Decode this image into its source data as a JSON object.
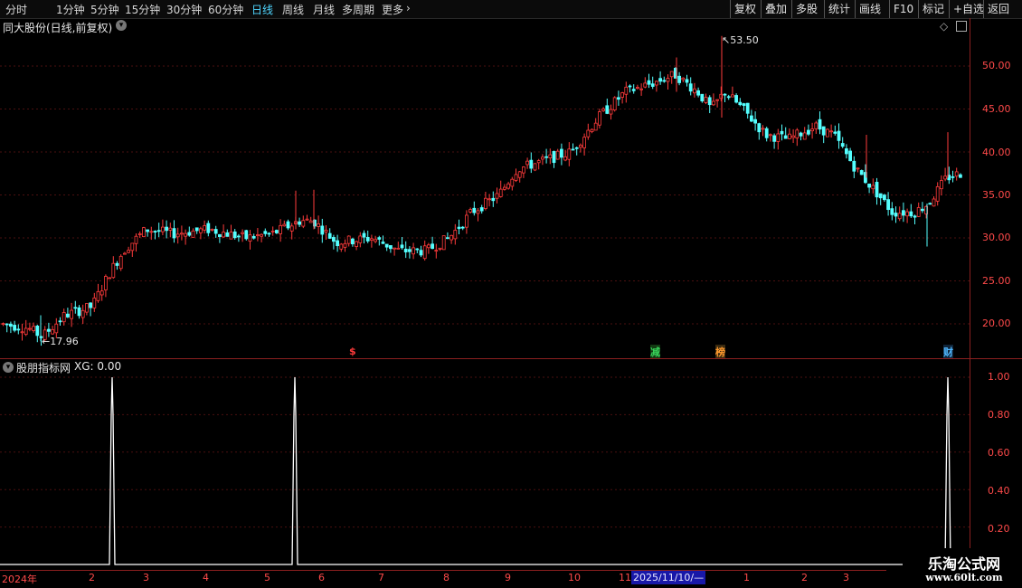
{
  "toolbar": {
    "periods": [
      "分时",
      "1分钟",
      "5分钟",
      "15分钟",
      "30分钟",
      "60分钟",
      "日线",
      "周线",
      "月线",
      "多周期",
      "更多"
    ],
    "active_period": "日线",
    "more_arrow": "›",
    "buttons": [
      "复权",
      "叠加",
      "多股",
      "统计",
      "画线",
      "F10",
      "标记",
      "+自选",
      "返回"
    ]
  },
  "main_panel": {
    "title": "同大股份(日线,前复权)",
    "price_axis": [
      "50.00",
      "45.00",
      "40.00",
      "35.00",
      "30.00",
      "25.00",
      "20.00"
    ],
    "high_label": "53.50",
    "low_label": "17.96",
    "markers": [
      {
        "text": "$",
        "color": "#ff3b3b"
      },
      {
        "text": "减",
        "color": "#38d45a"
      },
      {
        "text": "榜",
        "color": "#ff9a2e"
      },
      {
        "text": "财",
        "color": "#4fb8ff"
      }
    ],
    "colors": {
      "up": "#ff3b3b",
      "down": "#54ffff",
      "grid": "#4a0f0f",
      "axis": "#ff4a4a"
    }
  },
  "indicator_panel": {
    "title": "股朋指标网",
    "value_label": "XG: 0.00",
    "axis": [
      "1.00",
      "0.80",
      "0.60",
      "0.40",
      "0.20"
    ]
  },
  "chart_data": {
    "type": "line",
    "series": [
      {
        "name": "XG",
        "x": [
          0,
          1,
          2,
          3
        ],
        "values": [
          0,
          1,
          1,
          1
        ]
      }
    ],
    "ylim": [
      0,
      1
    ]
  },
  "time_axis": {
    "labels": [
      "2024年",
      "2",
      "3",
      "4",
      "5",
      "6",
      "7",
      "8",
      "9",
      "10",
      "11",
      "1",
      "2",
      "3"
    ],
    "highlight": "2025/11/10/—"
  },
  "watermark": {
    "line1": "乐淘公式网",
    "line2": "www.60lt.com"
  }
}
